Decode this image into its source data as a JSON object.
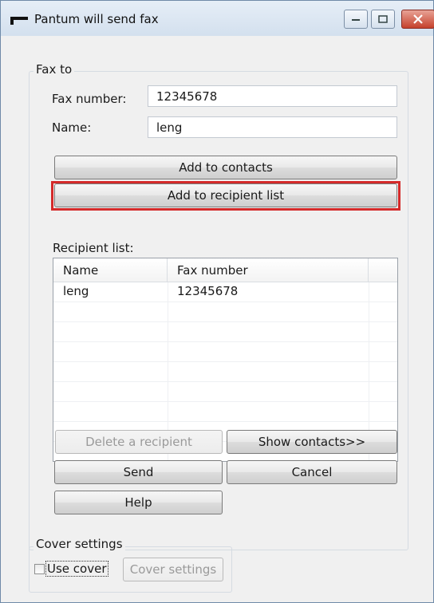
{
  "window": {
    "title": "Pantum will send fax"
  },
  "fax_to": {
    "group_label": "Fax to",
    "fax_number_label": "Fax number:",
    "fax_number_value": "12345678",
    "name_label": "Name:",
    "name_value": "leng",
    "add_to_contacts": "Add to contacts",
    "add_to_recipient_list": "Add to recipient list",
    "recipient_list_label": "Recipient list:",
    "columns": [
      "Name",
      "Fax number"
    ],
    "rows": [
      {
        "name": "leng",
        "fax": "12345678"
      }
    ],
    "delete_recipient": "Delete a recipient",
    "show_contacts": "Show contacts>>",
    "send": "Send",
    "cancel": "Cancel",
    "help": "Help"
  },
  "cover": {
    "group_label": "Cover settings",
    "use_cover_label": "Use cover",
    "use_cover_checked": false,
    "cover_settings_button": "Cover settings"
  },
  "colors": {
    "highlight": "#d42a2a",
    "close_button": "#c5412c"
  }
}
